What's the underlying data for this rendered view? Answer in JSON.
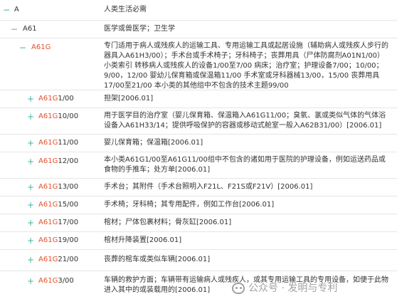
{
  "accent_color": "#43b3a6",
  "highlight_color": "#e2522d",
  "rows": [
    {
      "toggle": "−",
      "code_hl": "",
      "code_rest": "A",
      "desc": "人类生活必需"
    },
    {
      "toggle": "−",
      "code_hl": "",
      "code_rest": "A61",
      "desc": "医学或兽医学；卫生学"
    },
    {
      "toggle": "−",
      "code_hl": "A61G",
      "code_rest": "",
      "desc": "专门适用于病人或残疾人的运输工具、专用运输工具或起居设施（辅助病人或残疾人步行的器具入A61H3/00）；手术台或手术椅子；牙科椅子；丧葬用具（尸体防腐剂A01N1/00）小类索引 转移病人或残疾人的设备1/00至7/00 病床；治疗室；护理设备7/00；10/00；9/00，12/00 婴幼儿保育箱或保温箱11/00 手术室或牙科器械13/00，15/00 丧葬用具17/00至21/00 本小类的其他组中不包含的技术主题99/00"
    },
    {
      "toggle": "+",
      "code_hl": "A61G",
      "code_rest": "1/00",
      "desc": "担架[2006.01]"
    },
    {
      "toggle": "+",
      "code_hl": "A61G",
      "code_rest": "10/00",
      "desc": "用于医学目的治疗室（婴儿保育箱、保温箱入A61G11/00；臭氧、氯或类似气体的气体浴设备入A61H33/14；提供呼吸保护的容器或移动式舱室一般入A62B31/00）[2006.01]"
    },
    {
      "toggle": "+",
      "code_hl": "A61G",
      "code_rest": "11/00",
      "desc": "婴儿保育箱；保温箱[2006.01]"
    },
    {
      "toggle": "+",
      "code_hl": "A61G",
      "code_rest": "12/00",
      "desc": "本小类A61G1/00至A61G11/00组中不包含的诸如用于医院的护理设备，例如运送药品或食物的手推车；处方单[2006.01]"
    },
    {
      "toggle": "+",
      "code_hl": "A61G",
      "code_rest": "13/00",
      "desc": "手术台；其附件（手术台照明入F21L、F21S或F21V）[2006.01]"
    },
    {
      "toggle": "+",
      "code_hl": "A61G",
      "code_rest": "15/00",
      "desc": "手术椅；牙科椅；其专用配件，例如工作台[2006.01]"
    },
    {
      "toggle": "+",
      "code_hl": "A61G",
      "code_rest": "17/00",
      "desc": "棺材；尸体包裹材料；骨灰缸[2006.01]"
    },
    {
      "toggle": "+",
      "code_hl": "A61G",
      "code_rest": "19/00",
      "desc": "棺材升降装置[2006.01]"
    },
    {
      "toggle": "+",
      "code_hl": "A61G",
      "code_rest": "21/00",
      "desc": "丧葬的棺车或类似车辆[2006.01]"
    },
    {
      "toggle": "+",
      "code_hl": "A61G",
      "code_rest": "3/00",
      "desc": "车辆的救护方面；车辆带有运输病人或残疾人，或其专用运输工具的专用设备，如便于此物进入其中的或装载用的[2006.01]"
    }
  ],
  "watermark": "公众号 · 发明与专利"
}
